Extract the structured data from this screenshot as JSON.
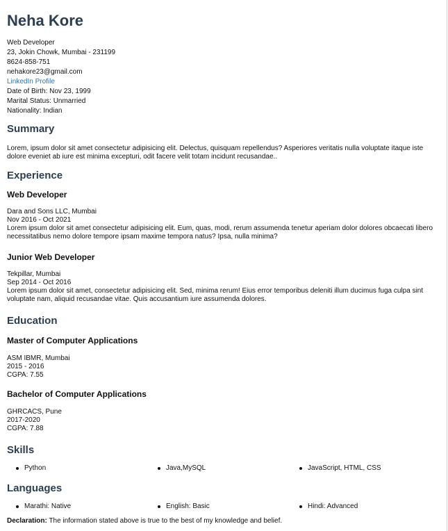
{
  "header": {
    "name": "Neha Kore",
    "role": "Web Developer",
    "address": "23, Jokin Chowk, Mumbai - 231199",
    "phone": "8624-858-751",
    "email": "nehakore23@gmail.com",
    "linkedin": "LinkedIn Profile",
    "dob": "Date of Birth: Nov 23, 1999",
    "marital": "Marital Status: Unmarried",
    "nationality": "Nationality: Indian"
  },
  "summary": {
    "title": "Summary",
    "text": "Lorem, ipsum dolor sit amet consectetur adipisicing elit. Delectus, quisquam repellendus? Asperiores veritatis nulla voluptate itaque iste dolore eveniet ab iure est minima excepturi, odit facere velit totam incidunt recusandae.."
  },
  "experience": {
    "title": "Experience",
    "items": [
      {
        "role": "Web Developer",
        "company": "Dara and Sons LLC, Mumbai",
        "dates": "Nov 2016 - Oct 2021",
        "description": "Lorem ipsum dolor sit amet consectetur adipisicing elit. Eum, quas, modi, rerum assumenda tenetur aperiam dolor dolores obcaecati libero necessitatibus nemo dolore tempore ipsam maxime tempora natus? Ipsa, nulla minima?"
      },
      {
        "role": "Junior Web Developer",
        "company": "Tekpillar, Mumbai",
        "dates": "Sep 2014 - Oct 2016",
        "description": "Lorem ipsum dolor sit amet, consectetur adipisicing elit. Sed, minima rerum! Eius error temporibus deleniti illum ducimus fuga culpa sint voluptate nam, aliquid recusandae vitae. Quis accusantium iure assumenda dolores."
      }
    ]
  },
  "education": {
    "title": "Education",
    "items": [
      {
        "degree": "Master of Computer Applications",
        "school": "ASM IBMR, Mumbai",
        "years": "2015 - 2016",
        "grade": "CGPA: 7.55"
      },
      {
        "degree": "Bachelor of Computer Applications",
        "school": "GHRCACS, Pune",
        "years": "2017-2020",
        "grade": "CGPA: 7.88"
      }
    ]
  },
  "skills": {
    "title": "Skills",
    "items": [
      "Python",
      "Java,MySQL",
      "JavaScript, HTML, CSS"
    ]
  },
  "languages": {
    "title": "Languages",
    "items": [
      "Marathi: Native",
      "English: Basic",
      "Hindi: Advanced"
    ]
  },
  "declaration": {
    "label": "Declaration:",
    "text": " The information stated above is true to the best of my knowledge and belief."
  }
}
